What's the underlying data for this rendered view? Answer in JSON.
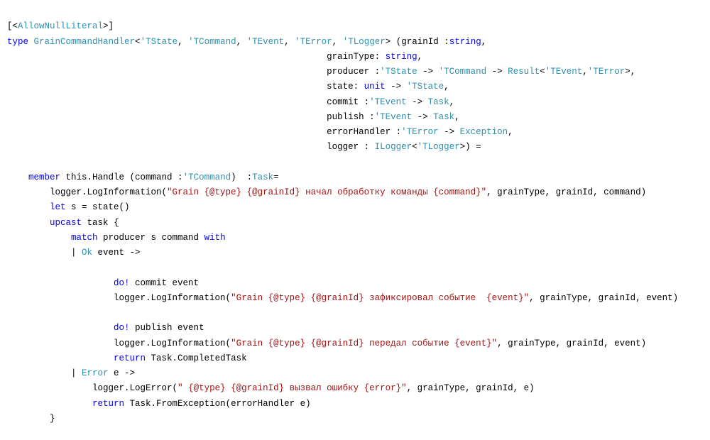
{
  "code": {
    "line1": {
      "openBracket": "[<",
      "attr": "AllowNullLiteral",
      "closeBracket": ">]"
    },
    "line2": {
      "kw_type": "type",
      "typeName": " GrainCommandHandler",
      "lt": "<",
      "tp1": "'TState",
      "sep1": ", ",
      "tp2": "'TCommand",
      "sep2": ", ",
      "tp3": "'TEvent",
      "sep3": ", ",
      "tp4": "'TError",
      "sep4": ", ",
      "tp5": "'TLogger",
      "gt": ">",
      "open": " (grainId :",
      "p1t": "string",
      "comma": ","
    },
    "p2": {
      "name": "grainType: ",
      "type": "string",
      "end": ","
    },
    "p3": {
      "name": "producer :",
      "t1": "'TState",
      "arrow1": " -> ",
      "t2": "'TCommand",
      "arrow2": " -> ",
      "res": "Result",
      "lt": "<",
      "ra": "'TEvent",
      "comma": ",",
      "rb": "'TError",
      "gt": ">",
      "end": ","
    },
    "p4": {
      "name": "state: ",
      "t1": "unit",
      "arrow": " -> ",
      "t2": "'TState",
      "end": ","
    },
    "p5": {
      "name": "commit :",
      "t1": "'TEvent",
      "arrow": " -> ",
      "t2": "Task",
      "end": ","
    },
    "p6": {
      "name": "publish :",
      "t1": "'TEvent",
      "arrow": " -> ",
      "t2": "Task",
      "end": ","
    },
    "p7": {
      "name": "errorHandler :",
      "t1": "'TError",
      "arrow": " -> ",
      "t2": "Exception",
      "end": ","
    },
    "p8": {
      "name": "logger : ",
      "t1": "ILogger",
      "lt": "<",
      "tp": "'TLogger",
      "gt": ">",
      "close": ") ="
    },
    "member_line": {
      "kw_member": "member",
      "this": " this.Handle (command :",
      "tcmd": "'TCommand",
      "close": ")  :",
      "task": "Task",
      "eq": "="
    },
    "log1": {
      "prefix": "logger.LogInformation(",
      "str": "\"Grain {@type} {@grainId} начал обработку команды {command}\"",
      "suffix": ", grainType, grainId, command)"
    },
    "let_line": {
      "kw_let": "let",
      "rest": " s = state()"
    },
    "upcast_line": {
      "kw_upcast": "upcast",
      "sp": " ",
      "task": "task",
      "brace": " {"
    },
    "match_line": {
      "kw_match": "match",
      "mid": " producer s command ",
      "kw_with": "with"
    },
    "ok_line": {
      "bar": "| ",
      "ok": "Ok",
      "rest": " event ->"
    },
    "do_commit": {
      "kw": "do!",
      "rest": " commit event"
    },
    "log2": {
      "prefix": "logger.LogInformation(",
      "str": "\"Grain {@type} {@grainId} зафиксировал событие  {event}\"",
      "suffix": ", grainType, grainId, event)"
    },
    "do_publish": {
      "kw": "do!",
      "rest": " publish event"
    },
    "log3": {
      "prefix": "logger.LogInformation(",
      "str": "\"Grain {@type} {@grainId} передал событие {event}\"",
      "suffix": ", grainType, grainId, event)"
    },
    "return1": {
      "kw": "return",
      "rest": " Task.CompletedTask"
    },
    "error_line": {
      "bar": "| ",
      "err": "Error",
      "rest": " e ->"
    },
    "log_err": {
      "prefix": "logger.LogError(",
      "str": "\" {@type} {@grainId} вызвал ошибку {error}\"",
      "suffix": ", grainType, grainId, e)"
    },
    "return2": {
      "kw": "return",
      "rest": " Task.FromException(errorHandler e)"
    },
    "close_brace": "}"
  },
  "indents": {
    "param": "                                                            ",
    "i1": "    ",
    "i2": "        ",
    "i3": "            ",
    "i4": "                ",
    "i5": "                    "
  }
}
